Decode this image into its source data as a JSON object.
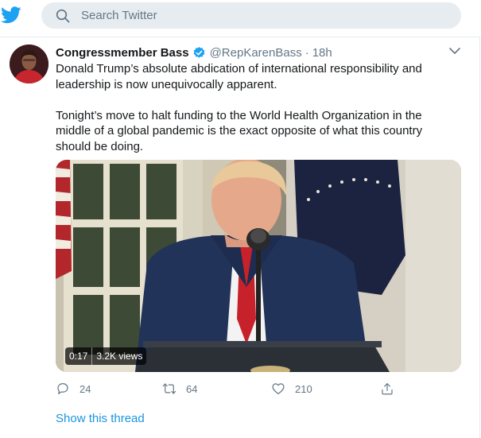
{
  "search": {
    "placeholder": "Search Twitter"
  },
  "tweet": {
    "display_name": "Congressmember Bass",
    "handle": "@RepKarenBass",
    "separator": "·",
    "time": "18h",
    "paragraphs": [
      "Donald Trump’s absolute abdication of international responsibility and leadership is now unequivocally apparent.",
      "Tonight’s move to halt funding to the World Health Organization in the middle of a global pandemic is the exact opposite of what this country should be doing."
    ],
    "video": {
      "duration": "0:17",
      "views": "3.2K views"
    },
    "actions": {
      "replies": "24",
      "retweets": "64",
      "likes": "210"
    },
    "show_thread": "Show this thread"
  },
  "colors": {
    "brand": "#1da1f2",
    "link": "#1b95e0",
    "muted": "#657786",
    "search_bg": "#e6ecf0"
  },
  "icons": [
    "twitter-logo-icon",
    "search-icon",
    "verified-badge-icon",
    "chevron-down-icon",
    "reply-icon",
    "retweet-icon",
    "like-icon",
    "share-icon"
  ]
}
